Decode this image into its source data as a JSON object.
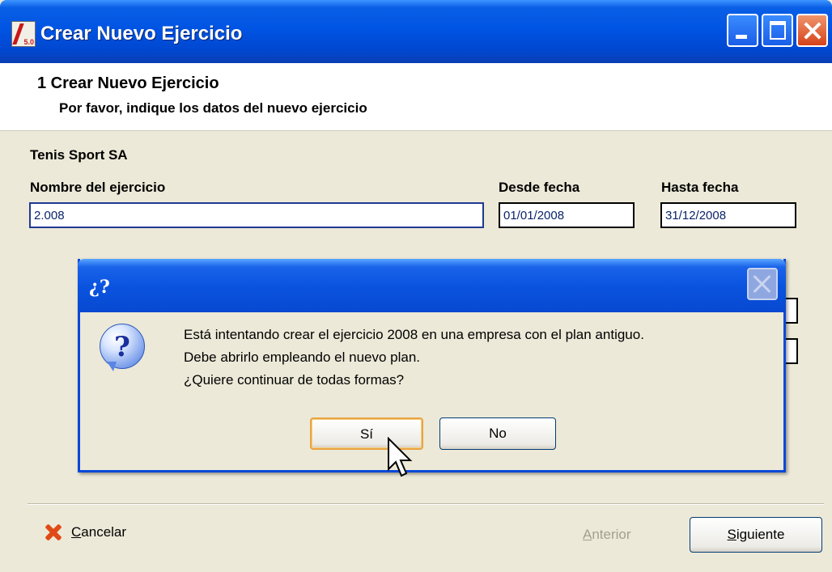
{
  "window": {
    "title": "Crear Nuevo Ejercicio",
    "app_icon_version": "5.0"
  },
  "header": {
    "step_title": "1  Crear Nuevo Ejercicio",
    "step_subtitle": "Por favor, indique los datos del nuevo ejercicio"
  },
  "form": {
    "company": "Tenis Sport SA",
    "name_label": "Nombre del ejercicio",
    "name_value": "2.008",
    "from_label": "Desde fecha",
    "from_value": "01/01/2008",
    "to_label": "Hasta fecha",
    "to_value": "31/12/2008"
  },
  "dialog": {
    "title": "¿?",
    "icon": "question-icon",
    "message_lines": [
      "Está intentando crear el ejercicio 2008 en una empresa con el plan antiguo.",
      "Debe abrirlo empleando el nuevo plan.",
      "¿Quiere continuar de todas formas?"
    ],
    "yes_label": "Sí",
    "no_label": "No"
  },
  "footer": {
    "cancel_label": "Cancelar",
    "back_label": "Anterior",
    "next_label": "Siguiente"
  },
  "colors": {
    "titlebar": "#0054e3",
    "window_bg": "#ece9d8",
    "cancel_icon": "#e04a16",
    "disabled_text": "#a49f8e"
  }
}
